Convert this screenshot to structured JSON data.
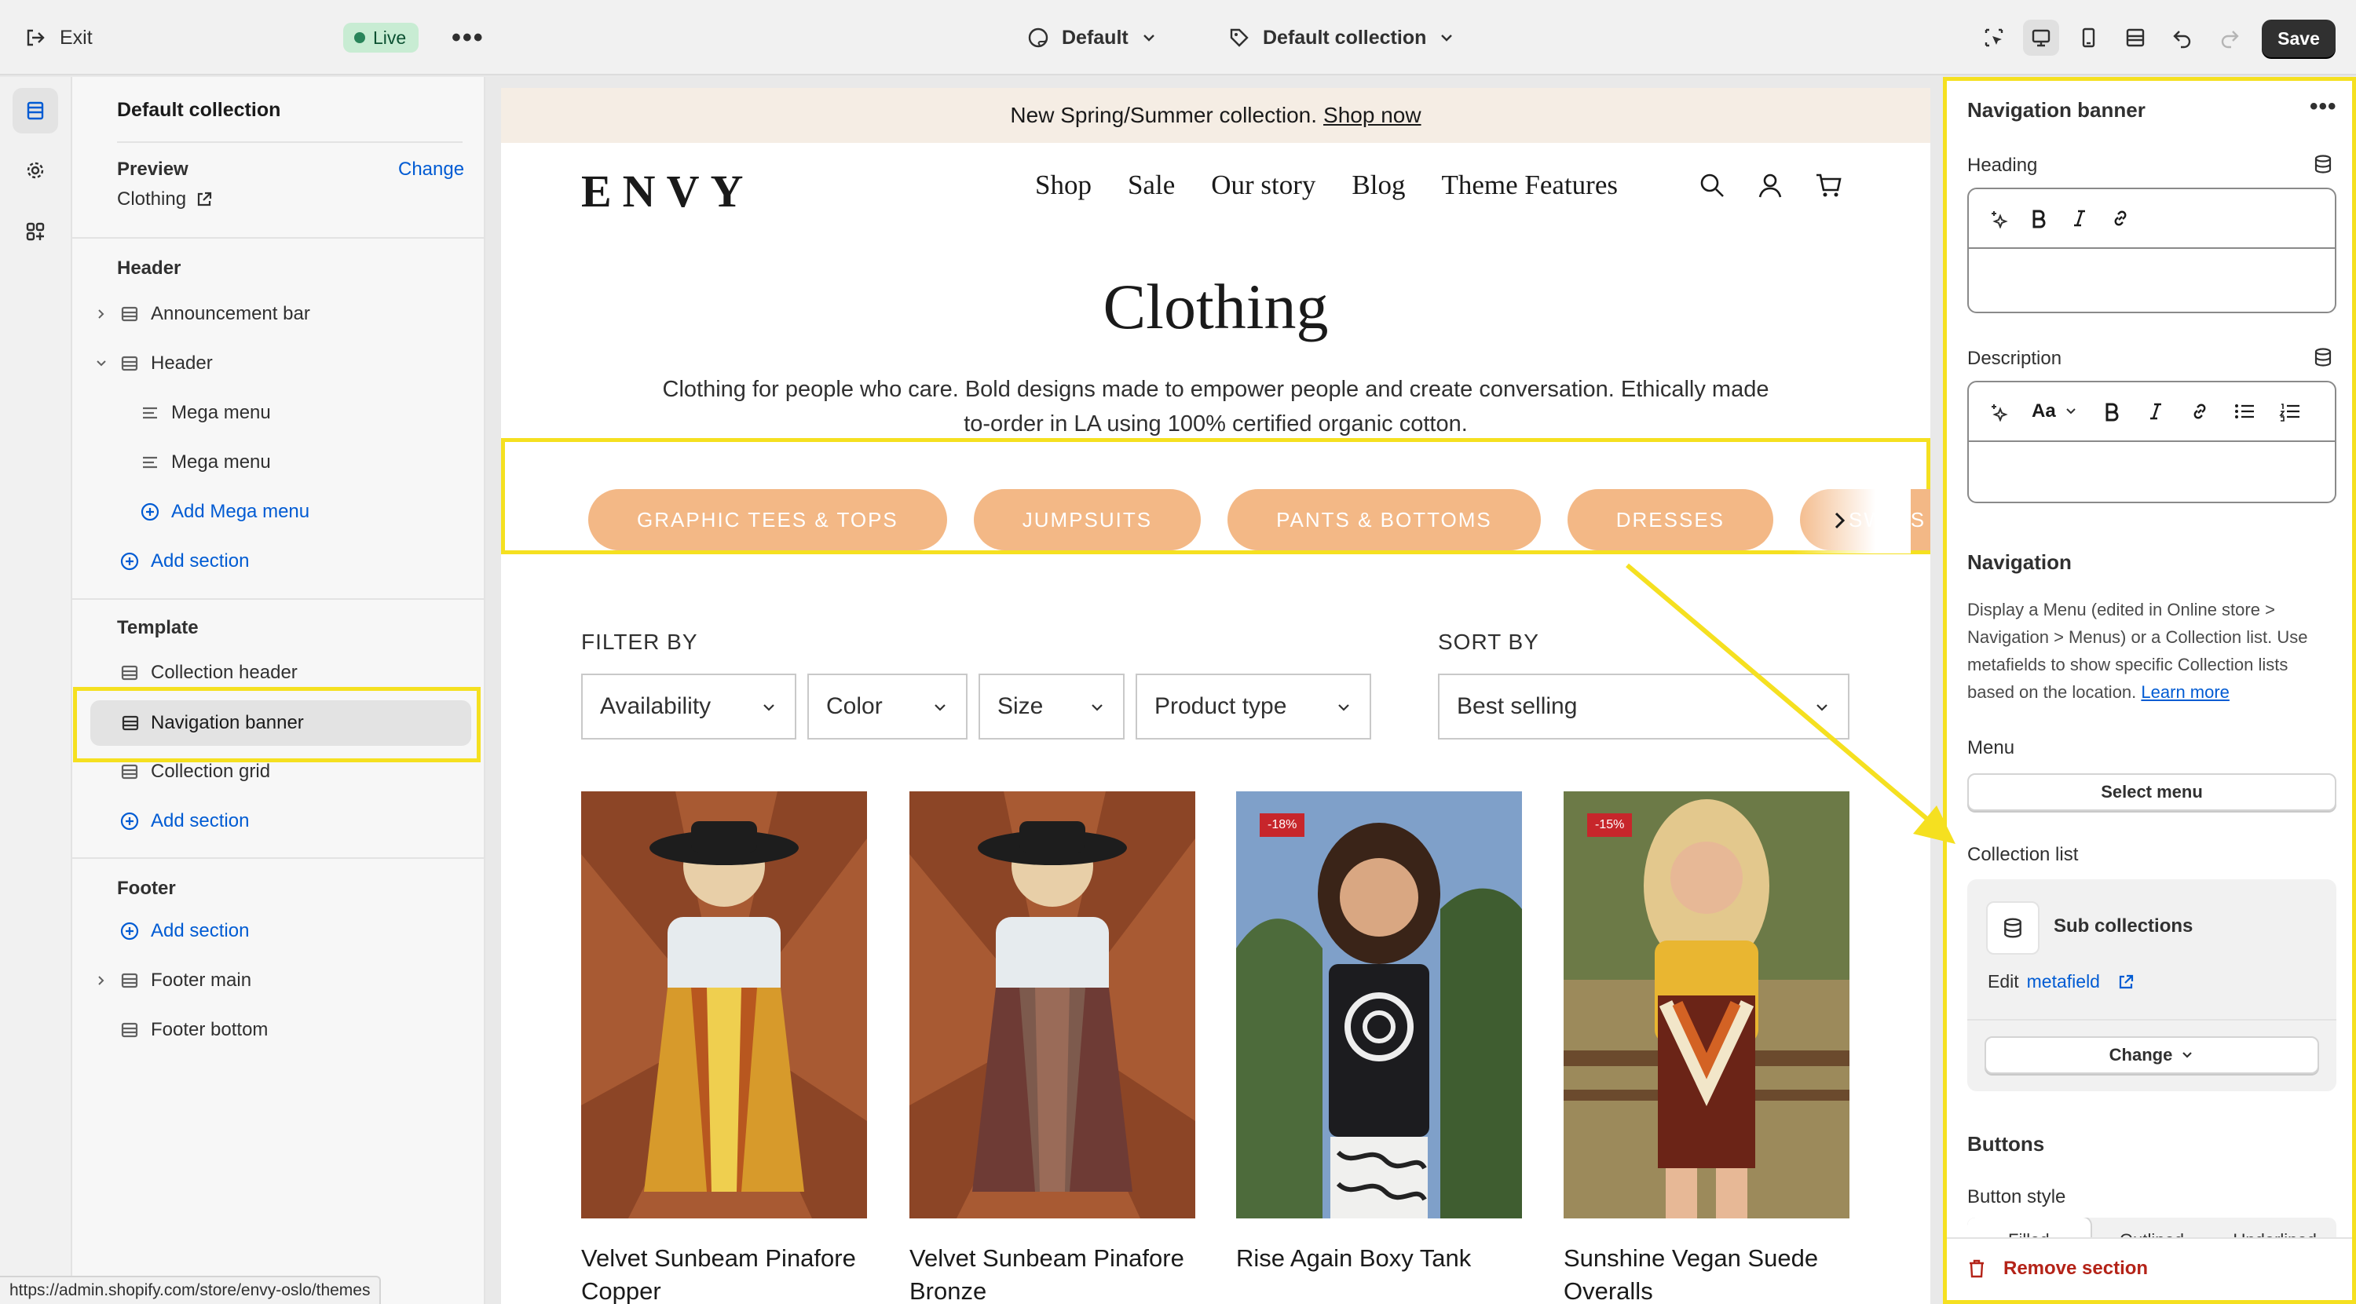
{
  "topbar": {
    "exit_label": "Exit",
    "live_label": "Live",
    "more_label": "•••",
    "theme_select": "Default",
    "template_select": "Default collection",
    "save_label": "Save"
  },
  "sidebar": {
    "title": "Default collection",
    "preview_label": "Preview",
    "preview_change": "Change",
    "preview_value": "Clothing",
    "header_group": "Header",
    "header_items": {
      "announcement_bar": "Announcement bar",
      "header": "Header",
      "mega_menu_1": "Mega menu",
      "mega_menu_2": "Mega menu",
      "add_mega_menu": "Add Mega menu",
      "add_section": "Add section"
    },
    "template_group": "Template",
    "template_items": {
      "collection_header": "Collection header",
      "navigation_banner": "Navigation banner",
      "collection_grid": "Collection grid",
      "add_section": "Add section"
    },
    "footer_group": "Footer",
    "footer_items": {
      "add_section": "Add section",
      "footer_main": "Footer main",
      "footer_bottom": "Footer bottom"
    }
  },
  "status_url": "https://admin.shopify.com/store/envy-oslo/themes",
  "storefront": {
    "announcement_text": "New Spring/Summer collection.",
    "announcement_link": "Shop now",
    "logo": "ENVY",
    "nav": [
      "Shop",
      "Sale",
      "Our story",
      "Blog",
      "Theme Features"
    ],
    "collection_title": "Clothing",
    "collection_description": "Clothing for people who care. Bold designs made to empower people and create conversation. Ethically made to-order in LA using 100% certified organic cotton.",
    "nav_pills": [
      "GRAPHIC TEES & TOPS",
      "JUMPSUITS",
      "PANTS & BOTTOMS",
      "DRESSES",
      "SWIMS"
    ],
    "filter_by_label": "FILTER BY",
    "sort_by_label": "SORT BY",
    "filters": [
      "Availability",
      "Color",
      "Size",
      "Product type"
    ],
    "sort_value": "Best selling",
    "products": [
      {
        "name": "Velvet Sunbeam Pinafore Copper",
        "badge": ""
      },
      {
        "name": "Velvet Sunbeam Pinafore Bronze",
        "badge": ""
      },
      {
        "name": "Rise Again Boxy Tank",
        "badge": "-18%"
      },
      {
        "name": "Sunshine Vegan Suede Overalls",
        "badge": "-15%"
      }
    ]
  },
  "settings": {
    "title": "Navigation banner",
    "heading_label": "Heading",
    "description_label": "Description",
    "font_btn": "Aa",
    "navigation_heading": "Navigation",
    "navigation_help": "Display a Menu (edited in Online store > Navigation > Menus) or a Collection list. Use metafields to show specific Collection lists based on the location.",
    "learn_more": "Learn more",
    "menu_label": "Menu",
    "select_menu": "Select menu",
    "collection_list_label": "Collection list",
    "sub_collections": "Sub collections",
    "edit_prefix": "Edit",
    "metafield_link": "metafield",
    "change_label": "Change",
    "buttons_heading": "Buttons",
    "button_style_label": "Button style",
    "button_styles": [
      "Filled",
      "Outlined",
      "Underlined"
    ],
    "remove_section": "Remove section"
  },
  "colors": {
    "highlight": "#f5e020",
    "pill": "#f3b886",
    "link": "#005bd3",
    "danger": "#b42318",
    "live": "#29845a"
  }
}
